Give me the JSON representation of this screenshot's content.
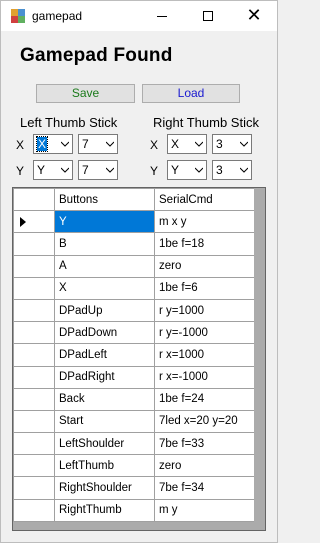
{
  "window": {
    "title": "gamepad"
  },
  "heading": "Gamepad Found",
  "buttons": {
    "save": "Save",
    "load": "Load"
  },
  "left_stick": {
    "label": "Left Thumb Stick",
    "x_label": "X",
    "y_label": "Y",
    "x_axis": "X",
    "x_value": "7",
    "y_axis": "Y",
    "y_value": "7"
  },
  "right_stick": {
    "label": "Right Thumb Stick",
    "x_label": "X",
    "y_label": "Y",
    "x_axis": "X",
    "x_value": "3",
    "y_axis": "Y",
    "y_value": "3"
  },
  "grid": {
    "columns": [
      "Buttons",
      "SerialCmd"
    ],
    "rows": [
      [
        "Y",
        "m x y"
      ],
      [
        "B",
        "1be f=18"
      ],
      [
        "A",
        "zero"
      ],
      [
        "X",
        "1be f=6"
      ],
      [
        "DPadUp",
        "r y=1000"
      ],
      [
        "DPadDown",
        "r y=-1000"
      ],
      [
        "DPadLeft",
        "r x=1000"
      ],
      [
        "DPadRight",
        "r x=-1000"
      ],
      [
        "Back",
        "1be f=24"
      ],
      [
        "Start",
        "7led x=20 y=20"
      ],
      [
        "LeftShoulder",
        "7be f=33"
      ],
      [
        "LeftThumb",
        "zero"
      ],
      [
        "RightShoulder",
        "7be f=34"
      ],
      [
        "RightThumb",
        "m y"
      ]
    ]
  }
}
